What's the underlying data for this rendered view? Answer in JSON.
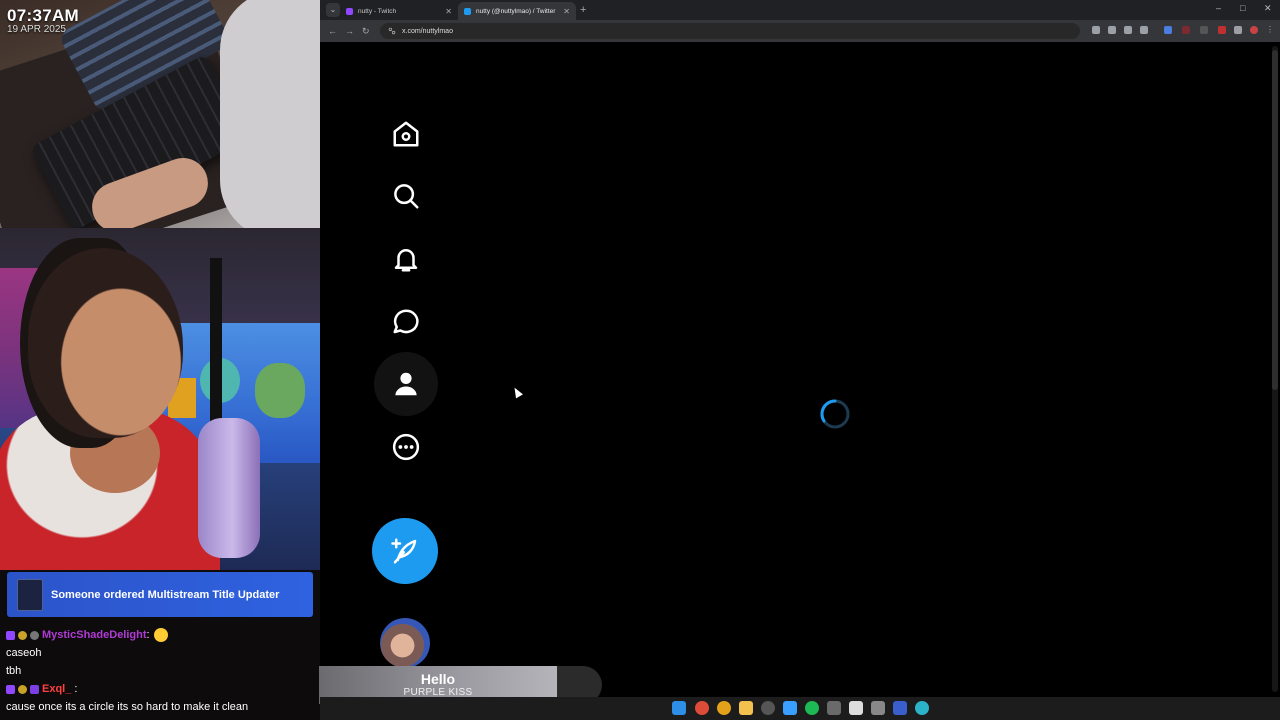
{
  "overlay": {
    "time": "07:37AM",
    "date": "19 APR 2025",
    "alert": "Someone ordered Multistream Title Updater"
  },
  "chat": [
    {
      "user": "MysticShadeDelight",
      "sep": ":",
      "message": ""
    },
    {
      "user": "",
      "sep": "",
      "message": "caseoh"
    },
    {
      "user": "",
      "sep": "",
      "message": "tbh"
    },
    {
      "user": "Exql_",
      "sep": ":",
      "message": "cause once its a circle its so hard to make it clean"
    }
  ],
  "browser": {
    "tabs": [
      {
        "title": "nutty - Twitch",
        "close": "✕",
        "color": "#9146ff"
      },
      {
        "title": "nutty (@nuttylmao) / Twitter",
        "close": "✕",
        "color": "#1d9bf0"
      }
    ],
    "new_tab": "+",
    "url": "x.com/nuttylmao",
    "window_controls": {
      "minimize": "–",
      "maximize": "□",
      "close": "✕"
    },
    "nav": {
      "back": "←",
      "forward": "→",
      "reload": "↻"
    }
  },
  "x_nav": {
    "items": [
      {
        "icon": "home-icon"
      },
      {
        "icon": "search-icon"
      },
      {
        "icon": "bell-icon"
      },
      {
        "icon": "message-icon"
      },
      {
        "icon": "profile-icon"
      },
      {
        "icon": "more-icon"
      }
    ],
    "post_icon": "feather-plus-icon",
    "accent": "#1d9bf0"
  },
  "now_playing": {
    "title": "Hello",
    "artist": "PURPLE KISS"
  }
}
